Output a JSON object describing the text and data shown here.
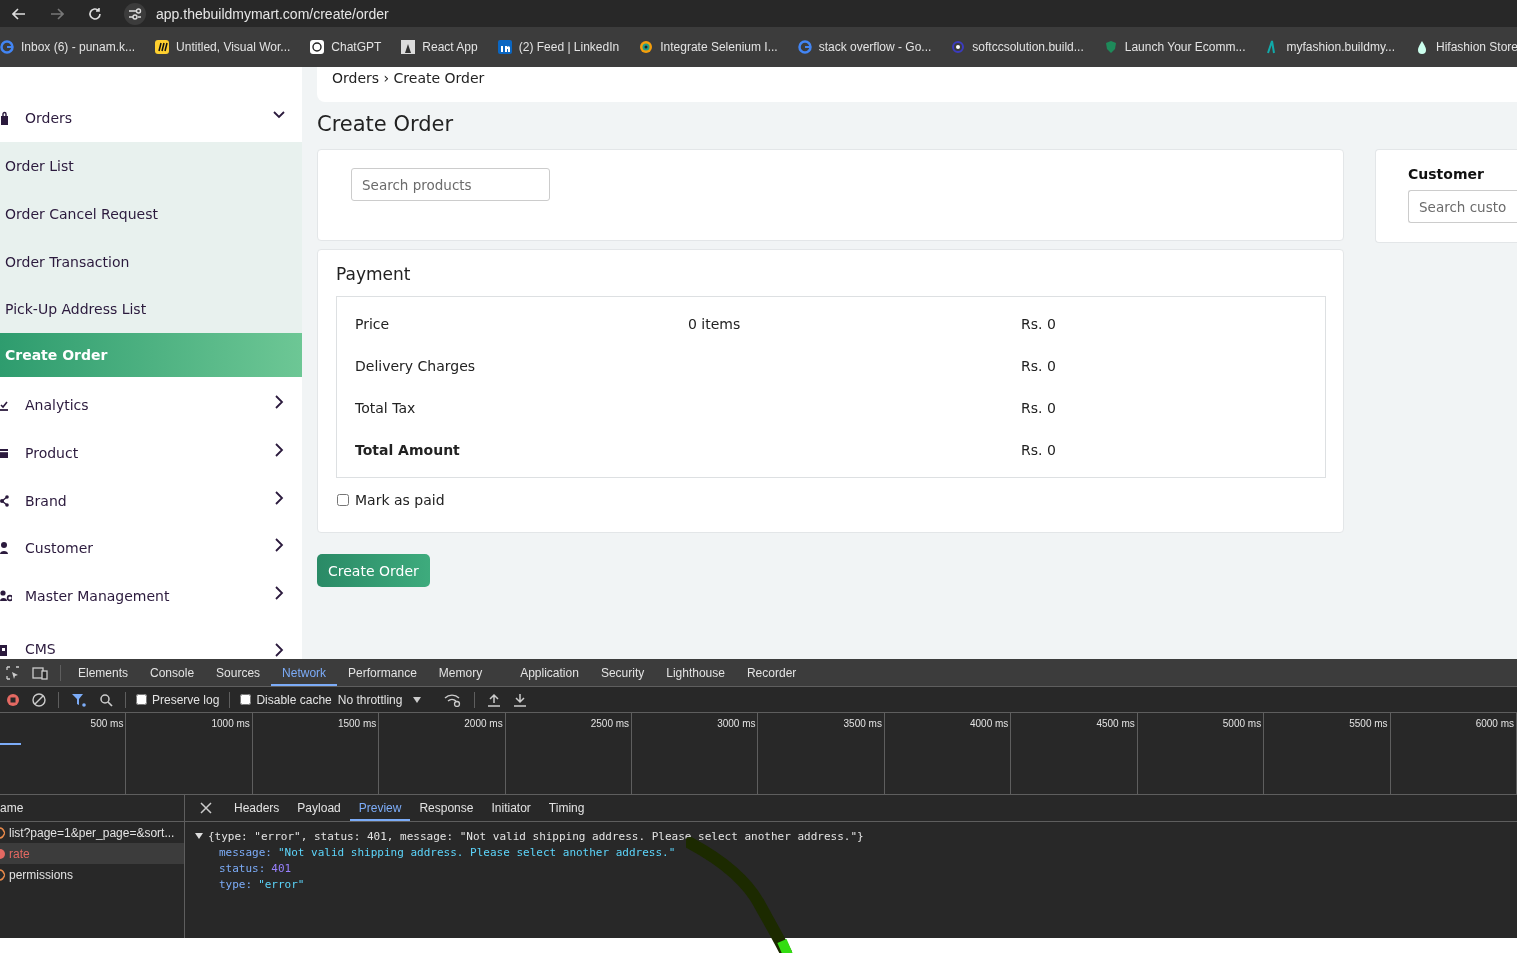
{
  "browser": {
    "url": "app.thebuildmymart.com/create/order",
    "bookmarks": [
      {
        "label": "Inbox (6) - punam.k...",
        "kind": "google"
      },
      {
        "label": "Untitled, Visual Wor...",
        "kind": "miro"
      },
      {
        "label": "ChatGPT",
        "kind": "chat"
      },
      {
        "label": "React App",
        "kind": "photo"
      },
      {
        "label": "(2) Feed | LinkedIn",
        "kind": "in"
      },
      {
        "label": "Integrate Selenium I...",
        "kind": "ring"
      },
      {
        "label": "stack overflow - Go...",
        "kind": "google"
      },
      {
        "label": "softccsolution.build...",
        "kind": "eye"
      },
      {
        "label": "Launch Your Ecomm...",
        "kind": "leaf"
      },
      {
        "label": "myfashion.buildmy...",
        "kind": "bar"
      },
      {
        "label": "Hifashion Store",
        "kind": "drop"
      }
    ]
  },
  "sidebar": {
    "items": [
      {
        "label": "Orders",
        "kind": "top",
        "expanded": true,
        "selected": false
      },
      {
        "label": "Order List",
        "kind": "sub",
        "selected": false
      },
      {
        "label": "Order Cancel Request",
        "kind": "sub",
        "selected": false
      },
      {
        "label": "Order Transaction",
        "kind": "sub",
        "selected": false
      },
      {
        "label": "Pick-Up Address List",
        "kind": "sub",
        "selected": false
      },
      {
        "label": "Create Order",
        "kind": "sub",
        "selected": true
      },
      {
        "label": "Analytics",
        "kind": "top",
        "expanded": false,
        "selected": false
      },
      {
        "label": "Product",
        "kind": "top",
        "expanded": false,
        "selected": false
      },
      {
        "label": "Brand",
        "kind": "top",
        "expanded": false,
        "selected": false
      },
      {
        "label": "Customer",
        "kind": "top",
        "expanded": false,
        "selected": false
      },
      {
        "label": "Master Management",
        "kind": "top",
        "expanded": false,
        "selected": false
      },
      {
        "label": "CMS",
        "kind": "top",
        "expanded": false,
        "selected": false
      }
    ]
  },
  "breadcrumb": "Orders › Create Order",
  "page_title": "Create Order",
  "product_search": {
    "placeholder": "Search products"
  },
  "payment": {
    "title": "Payment",
    "rows": [
      {
        "label": "Price",
        "count": "0 items",
        "value": "Rs. 0",
        "bold": false
      },
      {
        "label": "Delivery Charges",
        "value": "Rs. 0",
        "bold": false
      },
      {
        "label": "Total Tax",
        "value": "Rs. 0",
        "bold": false
      },
      {
        "label": "Total Amount",
        "value": "Rs. 0",
        "bold": true
      }
    ],
    "mark_paid": {
      "label": "Mark as paid",
      "checked": false
    }
  },
  "create_button": "Create Order",
  "customer": {
    "title": "Customer",
    "placeholder": "Search custo"
  },
  "devtools": {
    "tabs": [
      {
        "label": "Elements",
        "selected": false
      },
      {
        "label": "Console",
        "selected": false
      },
      {
        "label": "Sources",
        "selected": false
      },
      {
        "label": "Network",
        "selected": true
      },
      {
        "label": "Performance",
        "selected": false
      },
      {
        "label": "Memory",
        "selected": false
      },
      {
        "label": "Application",
        "selected": false
      },
      {
        "label": "Security",
        "selected": false
      },
      {
        "label": "Lighthouse",
        "selected": false
      },
      {
        "label": "Recorder",
        "selected": false
      }
    ],
    "preserve_log": {
      "label": "Preserve log",
      "checked": false
    },
    "disable_cache": {
      "label": "Disable cache",
      "checked": false
    },
    "throttling": "No throttling",
    "ticks": [
      "500 ms",
      "1000 ms",
      "1500 ms",
      "2000 ms",
      "2500 ms",
      "3000 ms",
      "3500 ms",
      "4000 ms",
      "4500 ms",
      "5000 ms",
      "5500 ms",
      "6000 ms"
    ],
    "name_header": "ame",
    "requests": [
      {
        "name": "list?page=1&per_page=&sort...",
        "failed": false,
        "selected": false
      },
      {
        "name": "rate",
        "failed": true,
        "selected": true
      },
      {
        "name": "permissions",
        "failed": false,
        "selected": false
      }
    ],
    "detail_tabs": [
      {
        "label": "Headers",
        "selected": false
      },
      {
        "label": "Payload",
        "selected": false
      },
      {
        "label": "Preview",
        "selected": true
      },
      {
        "label": "Response",
        "selected": false
      },
      {
        "label": "Initiator",
        "selected": false
      },
      {
        "label": "Timing",
        "selected": false
      }
    ],
    "preview": {
      "summary": "{type: \"error\", status: 401, message: \"Not valid shipping address. Please select another address.\"}",
      "expanded": true,
      "fields": [
        {
          "key": "message:",
          "value": "\"Not valid shipping address. Please select another address.\"",
          "kind": "string"
        },
        {
          "key": "status:",
          "value": "401",
          "kind": "number"
        },
        {
          "key": "type:",
          "value": "\"error\"",
          "kind": "string"
        }
      ]
    }
  }
}
